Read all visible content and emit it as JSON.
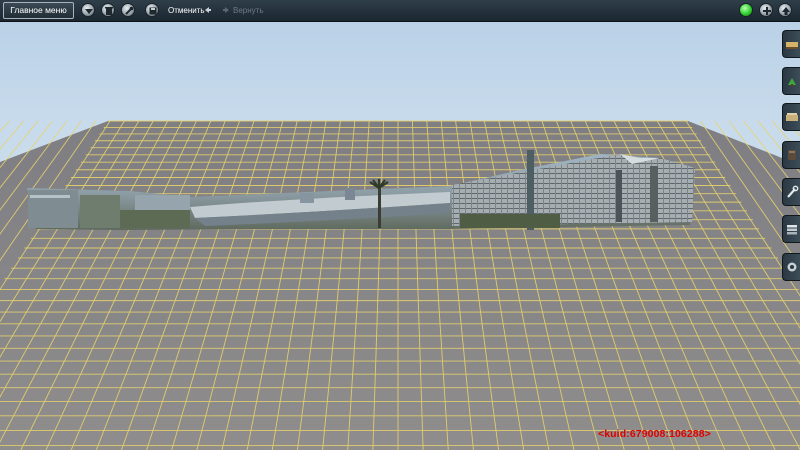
{
  "toolbar": {
    "main_menu_label": "Главное меню",
    "undo_label": "Отменить",
    "redo_label": "Вернуть"
  },
  "status": {
    "uuid_text": "<kuid:679008:106288>"
  },
  "colors": {
    "toolbar_bg": "#1e2a33",
    "ground": "#86858a",
    "grid_lines": "#e7d36f",
    "sky": "#c5d8ea",
    "status_text": "#e00000",
    "status_ok": "#2fd12f"
  }
}
